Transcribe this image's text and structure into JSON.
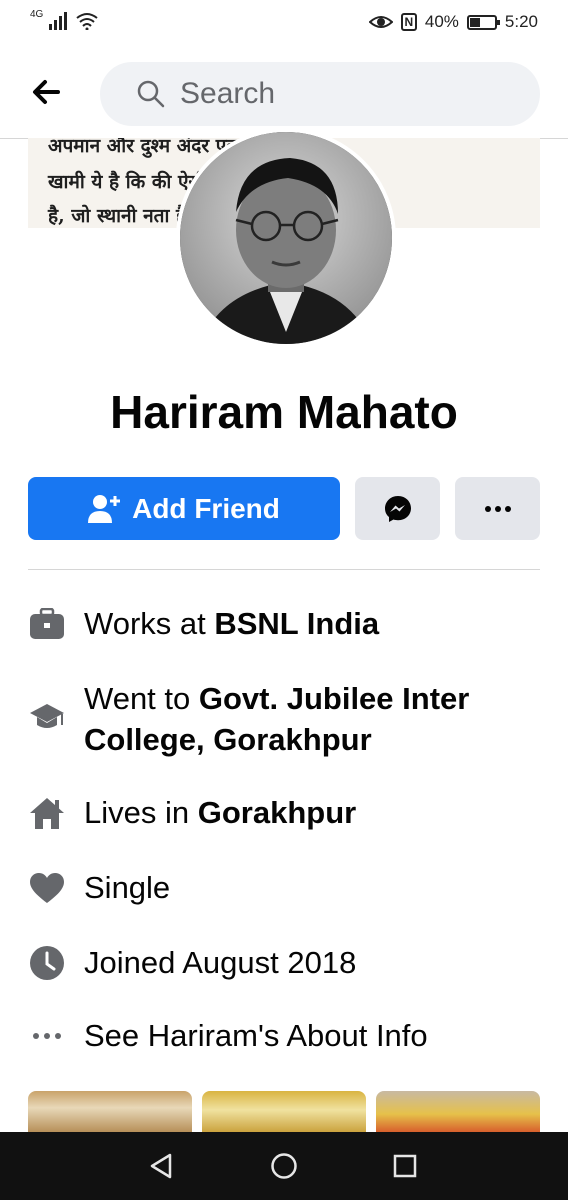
{
  "status_bar": {
    "network": "4G",
    "battery": "40%",
    "battery_level": 0.4,
    "time": "5:20"
  },
  "header": {
    "back_icon": "back-arrow-icon",
    "search_placeholder": "Search"
  },
  "cover": {
    "lines": [
      "अपमान और दुश्म                               अंदर एक अन्य",
      "खामी ये है कि                                 की ऐसी प्रणाली",
      "है, जो स्थानी                                 नता है। एक"
    ]
  },
  "profile": {
    "name": "Hariram Mahato"
  },
  "actions": {
    "add_friend_label": "Add Friend",
    "add_friend_icon": "add-person-icon",
    "messenger_icon": "messenger-icon",
    "more_icon": "more-dots-icon",
    "accent": "#1877f2"
  },
  "about": {
    "work": {
      "prefix": "Works at ",
      "value": "BSNL India",
      "icon": "briefcase-icon"
    },
    "education": {
      "prefix": "Went to ",
      "value_line1": "Govt. Jubilee Inter",
      "value_line2": "College, Gorakhpur",
      "icon": "graduation-cap-icon"
    },
    "home": {
      "prefix": "Lives in ",
      "value": "Gorakhpur",
      "icon": "home-icon"
    },
    "relationship": {
      "text": "Single",
      "icon": "heart-icon"
    },
    "joined": {
      "text": "Joined August 2018",
      "icon": "clock-icon"
    },
    "see_about": {
      "text": "See Hariram's About Info",
      "icon": "more-dots-icon"
    }
  },
  "nav": {
    "back": "nav-back-icon",
    "home": "nav-home-icon",
    "recents": "nav-recents-icon"
  }
}
